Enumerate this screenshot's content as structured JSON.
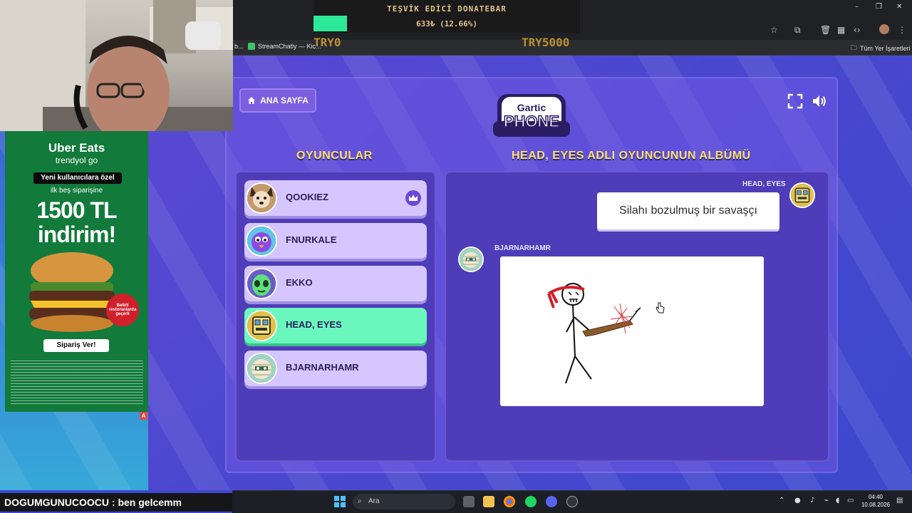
{
  "browser": {
    "bookmarks": [
      {
        "label": "StreamChatly — Kic...",
        "icon": "streamchatly-icon"
      },
      {
        "label": "Tüm Yer İşaretleri",
        "icon": "folder-icon"
      }
    ],
    "bookmark_prefix": "b..."
  },
  "donation": {
    "title": "TEŞVİK EDİCİ DONATEBAR",
    "amount": "633₺ (12.66%)",
    "progress": 0.1266,
    "min_label": "TRY0",
    "max_label": "TRY5000",
    "bar_color": "#2ee89a"
  },
  "game": {
    "home_button": "ANA SAYFA",
    "logo_top": "Gartic",
    "logo_bottom": "PHONE",
    "players_title": "OYUNCULAR",
    "album_title": "HEAD, EYES ADLI OYUNCUNUN ALBÜMÜ",
    "players": [
      {
        "name": "QOOKIEZ",
        "host": true,
        "active": false,
        "avatar": "dog"
      },
      {
        "name": "FNURKALE",
        "host": false,
        "active": false,
        "avatar": "bird"
      },
      {
        "name": "EKKO",
        "host": false,
        "active": false,
        "avatar": "alien"
      },
      {
        "name": "HEAD, EYES",
        "host": false,
        "active": true,
        "avatar": "robot"
      },
      {
        "name": "BJARNARHAMR",
        "host": false,
        "active": false,
        "avatar": "mummy"
      }
    ],
    "album": {
      "prompt_author": "HEAD, EYES",
      "prompt_text": "Silahı bozulmuş bir savaşçı",
      "drawing_author": "BJARNARHAMR"
    }
  },
  "ad": {
    "brand_line1": "Uber Eats",
    "brand_line2": "trendyol go",
    "pill": "Yeni kullanıcılara özel",
    "sub": "ilk beş siparişine",
    "big_line1": "1500 TL",
    "big_line2": "indirim!",
    "badge": "Belirli restoranlarda geçerli",
    "cta": "Sipariş Ver!",
    "mark": "A"
  },
  "chat": {
    "user": "DOGUMGUNUCOOCU",
    "message": "ben gelcemm"
  },
  "taskbar": {
    "search_placeholder": "Ara",
    "time": "04:40",
    "date": "10.08.2026"
  }
}
